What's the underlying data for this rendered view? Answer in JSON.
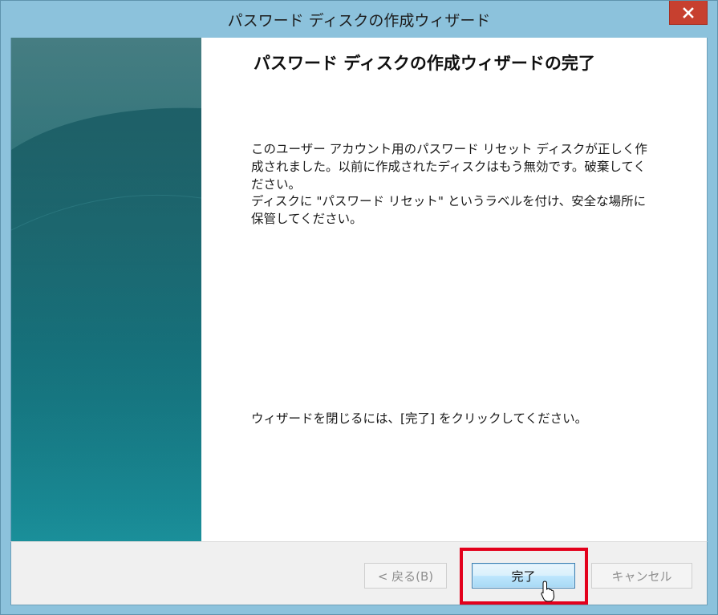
{
  "window": {
    "title": "パスワード ディスクの作成ウィザード",
    "close_glyph": "✕"
  },
  "page": {
    "heading": "パスワード ディスクの作成ウィザードの完了",
    "paragraph1": "このユーザー アカウント用のパスワード リセット ディスクが正しく作成されました。以前に作成されたディスクはもう無効です。破棄してください。",
    "paragraph2": "ディスクに \"パスワード リセット\" というラベルを付け、安全な場所に保管してください。",
    "paragraph3": "ウィザードを閉じるには、[完了] をクリックしてください。"
  },
  "buttons": {
    "back_label": "< 戻る(B)",
    "finish_label": "完了",
    "cancel_label": "キャンセル"
  },
  "colors": {
    "highlight": "#e3001b",
    "close_button": "#c7402f",
    "side_panel": "#107985"
  },
  "icons": {
    "close": "close-icon",
    "cursor": "mouse-pointer-icon"
  }
}
